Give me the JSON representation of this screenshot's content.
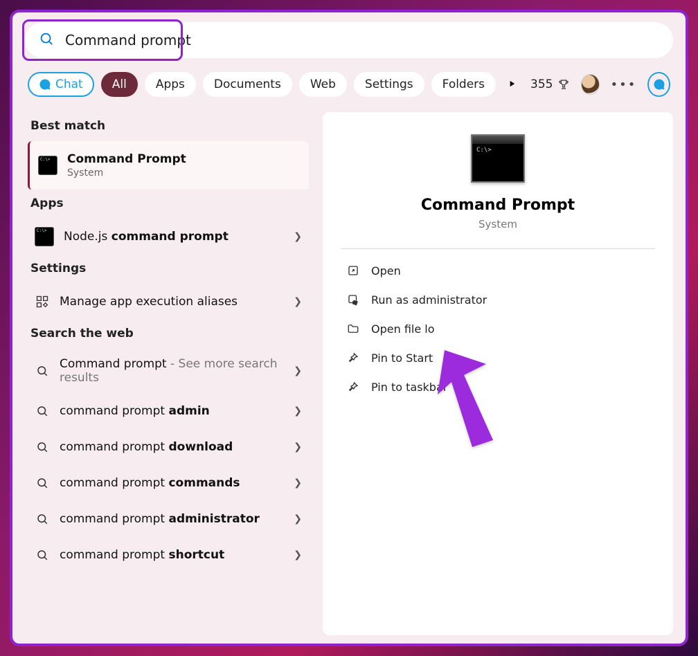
{
  "search": {
    "query": "Command prompt"
  },
  "tabs": {
    "chat": "Chat",
    "all": "All",
    "apps": "Apps",
    "documents": "Documents",
    "web": "Web",
    "settings": "Settings",
    "folders": "Folders"
  },
  "rewards": {
    "points": "355"
  },
  "left": {
    "best_match_label": "Best match",
    "best": {
      "title": "Command Prompt",
      "subtitle": "System"
    },
    "apps_label": "Apps",
    "apps": [
      {
        "prefix": "Node.js ",
        "bold": "command prompt"
      }
    ],
    "settings_label": "Settings",
    "settings": [
      {
        "title": "Manage app execution aliases"
      }
    ],
    "web_label": "Search the web",
    "web": [
      {
        "prefix": "Command prompt",
        "suffix": " - See more search results"
      },
      {
        "prefix": "command prompt ",
        "bold": "admin"
      },
      {
        "prefix": "command prompt ",
        "bold": "download"
      },
      {
        "prefix": "command prompt ",
        "bold": "commands"
      },
      {
        "prefix": "command prompt ",
        "bold": "administrator"
      },
      {
        "prefix": "command prompt ",
        "bold": "shortcut"
      }
    ]
  },
  "detail": {
    "title": "Command Prompt",
    "subtitle": "System",
    "actions": {
      "open": "Open",
      "run_admin": "Run as administrator",
      "open_file_location": "Open file lo",
      "pin_start": "Pin to Start",
      "pin_taskbar": "Pin to taskbar"
    }
  }
}
